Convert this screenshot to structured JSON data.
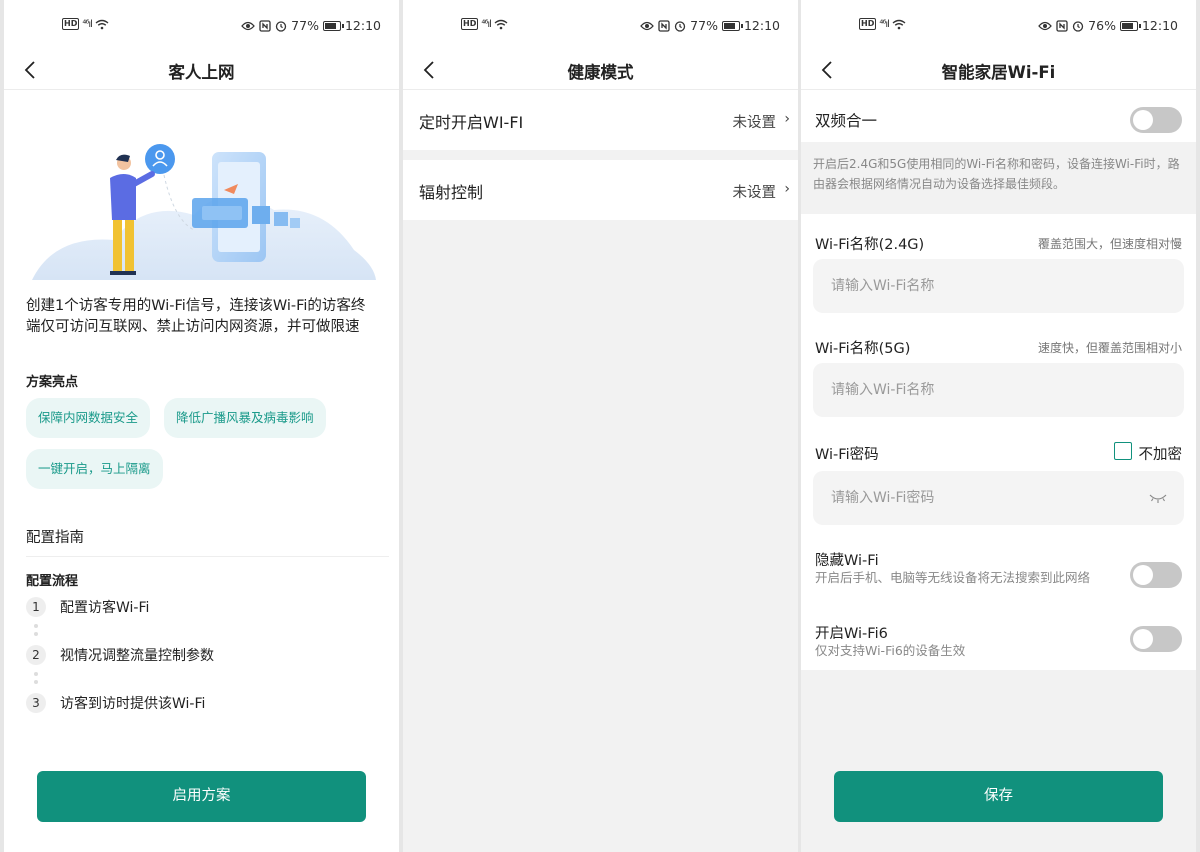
{
  "status": {
    "screens": [
      {
        "battery": "77%",
        "time": "12:10",
        "battery_level": 0.77
      },
      {
        "battery": "77%",
        "time": "12:10",
        "battery_level": 0.77
      },
      {
        "battery": "76%",
        "time": "12:10",
        "battery_level": 0.76
      }
    ],
    "hd": "HD",
    "signal": "⁴⁶ıl",
    "icons": [
      "hd-icon",
      "signal-icon",
      "wifi-icon",
      "eye-icon",
      "nfc-icon",
      "alarm-icon",
      "battery-icon"
    ]
  },
  "guest": {
    "title": "客人上网",
    "description": "创建1个访客专用的Wi-Fi信号，连接该Wi-Fi的访客终端仅可访问互联网、禁止访问内网资源，并可做限速",
    "highlights_label": "方案亮点",
    "chips": [
      "保障内网数据安全",
      "降低广播风暴及病毒影响",
      "一键开启，马上隔离"
    ],
    "guide_title": "配置指南",
    "flow_label": "配置流程",
    "steps": [
      {
        "num": "1",
        "text": "配置访客Wi-Fi"
      },
      {
        "num": "2",
        "text": "视情况调整流量控制参数"
      },
      {
        "num": "3",
        "text": "访客到访时提供该Wi-Fi"
      }
    ],
    "enable_button": "启用方案"
  },
  "health": {
    "title": "健康模式",
    "rows": [
      {
        "label": "定时开启WI-FI",
        "value": "未设置"
      },
      {
        "label": "辐射控制",
        "value": "未设置"
      }
    ]
  },
  "smart": {
    "title": "智能家居Wi-Fi",
    "dual_band_label": "双频合一",
    "dual_band_on": false,
    "dual_band_hint": "开启后2.4G和5G使用相同的Wi-Fi名称和密码，设备连接Wi-Fi时，路由器会根据网络情况自动为设备选择最佳频段。",
    "wifi24_label": "Wi-Fi名称(2.4G)",
    "wifi24_note": "覆盖范围大，但速度相对慢",
    "wifi24_placeholder": "请输入Wi-Fi名称",
    "wifi5_label": "Wi-Fi名称(5G)",
    "wifi5_note": "速度快，但覆盖范围相对小",
    "wifi5_placeholder": "请输入Wi-Fi名称",
    "password_label": "Wi-Fi密码",
    "no_encrypt_label": "不加密",
    "no_encrypt_checked": false,
    "password_placeholder": "请输入Wi-Fi密码",
    "hide_label": "隐藏Wi-Fi",
    "hide_sub": "开启后手机、电脑等无线设备将无法搜索到此网络",
    "hide_on": false,
    "wifi6_label": "开启Wi-Fi6",
    "wifi6_sub": "仅对支持Wi-Fi6的设备生效",
    "wifi6_on": false,
    "save_button": "保存"
  },
  "colors": {
    "accent": "#11917d",
    "chip_bg": "#eaf6f5",
    "chip_text": "#1a9a8a",
    "toggle_off": "#c7c7c7",
    "page_bg": "#f2f2f2"
  }
}
